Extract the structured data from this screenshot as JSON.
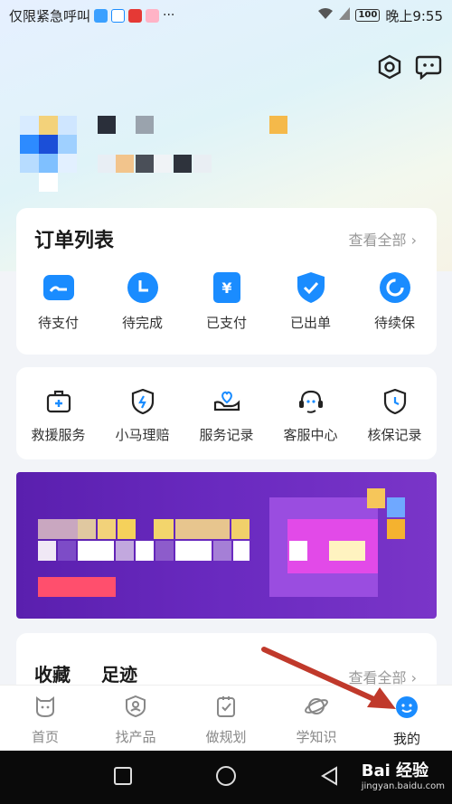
{
  "status_bar": {
    "carrier": "仅限紧急呼叫",
    "battery": "100",
    "time": "晚上9:55"
  },
  "orders": {
    "title": "订单列表",
    "see_all": "查看全部 ›",
    "items": [
      {
        "label": "待支付",
        "icon": "wallet-icon"
      },
      {
        "label": "待完成",
        "icon": "clock-icon"
      },
      {
        "label": "已支付",
        "icon": "yen-icon"
      },
      {
        "label": "已出单",
        "icon": "shield-check-icon"
      },
      {
        "label": "待续保",
        "icon": "renew-icon"
      }
    ]
  },
  "services": {
    "items": [
      {
        "label": "救援服务",
        "icon": "medkit-icon"
      },
      {
        "label": "小马理赔",
        "icon": "lightning-shield-icon"
      },
      {
        "label": "服务记录",
        "icon": "hands-heart-icon"
      },
      {
        "label": "客服中心",
        "icon": "headset-icon"
      },
      {
        "label": "核保记录",
        "icon": "shield-clock-icon"
      }
    ]
  },
  "favorites": {
    "tab_collect": "收藏",
    "tab_footprint": "足迹",
    "see_all": "查看全部 ›"
  },
  "bottom_nav": {
    "items": [
      {
        "label": "首页",
        "icon": "home-bear-icon"
      },
      {
        "label": "找产品",
        "icon": "find-product-icon"
      },
      {
        "label": "做规划",
        "icon": "plan-icon"
      },
      {
        "label": "学知识",
        "icon": "planet-icon"
      },
      {
        "label": "我的",
        "icon": "smile-icon",
        "active": true
      }
    ]
  },
  "watermark": {
    "brand": "Bai 经验",
    "url": "jingyan.baidu.com"
  },
  "colors": {
    "accent": "#1a8cff",
    "banner": "#6a2ac0",
    "arrow": "#c0392b"
  }
}
